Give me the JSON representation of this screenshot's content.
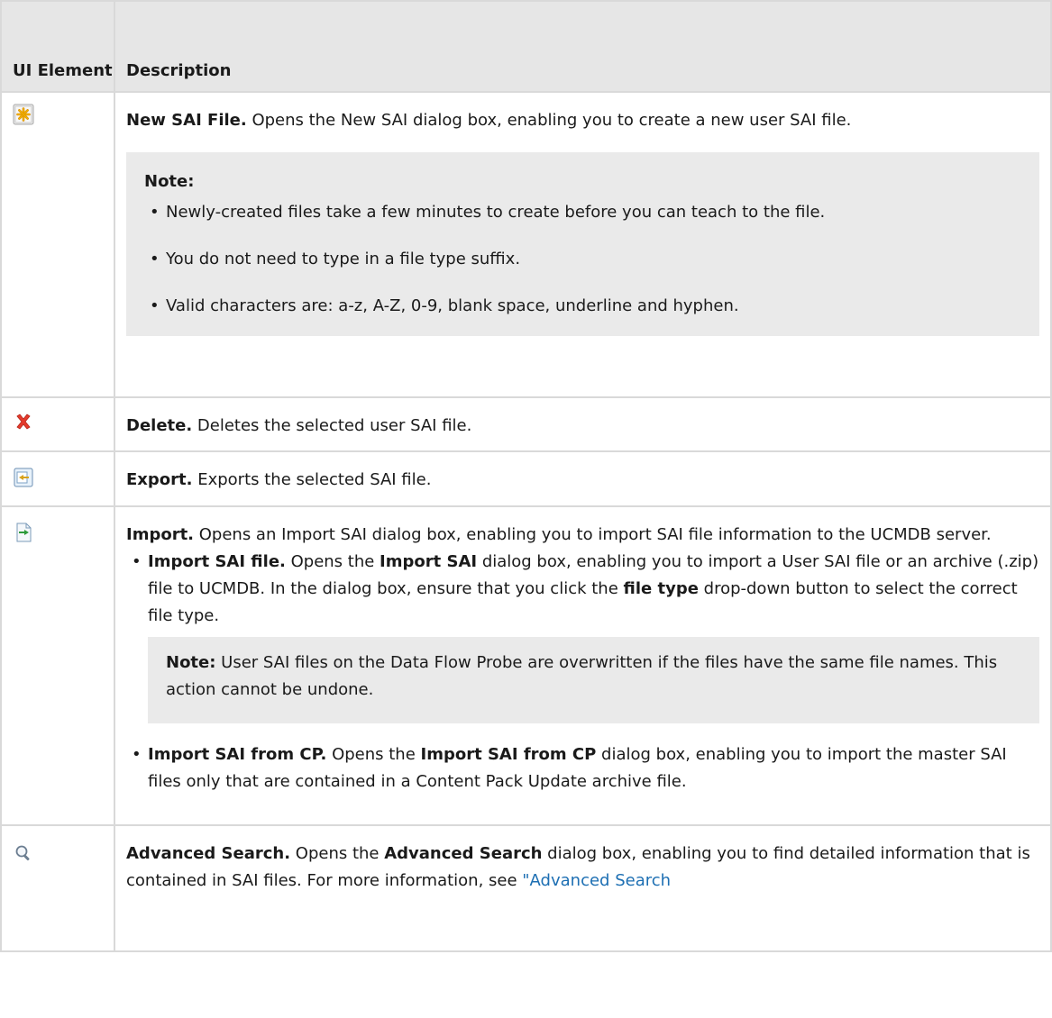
{
  "header": {
    "col1": "UI Element",
    "col2": "Description"
  },
  "rows": [
    {
      "icon": "new-file-icon",
      "title": "New SAI File.",
      "text": " Opens the New SAI dialog box, enabling you to create a new user SAI file.",
      "note_label": "Note:",
      "note_items": [
        "Newly-created files take a few minutes to create before you can teach to the file.",
        "You do not need to type in a file type suffix.",
        "Valid characters are: a-z, A-Z, 0-9, blank space, underline and hyphen."
      ]
    },
    {
      "icon": "delete-icon",
      "title": "Delete.",
      "text": " Deletes the selected user SAI file."
    },
    {
      "icon": "export-icon",
      "title": "Export.",
      "text": " Exports the selected SAI file."
    },
    {
      "icon": "import-icon",
      "title": "Import.",
      "text": " Opens an Import SAI dialog box, enabling you to import SAI file information to the UCMDB server.",
      "sub1": {
        "title": "Import SAI file.",
        "t1": " Opens the ",
        "b1": "Import SAI",
        "t2": " dialog box, enabling you to import a User SAI file or an archive (.zip) file to UCMDB. In the dialog box, ensure that you click the ",
        "b2": "file type",
        "t3": " drop-down button to select the correct file type.",
        "note_label": "Note:",
        "note_text": " User SAI files on the Data Flow Probe are overwritten if the files have the same file names. This action cannot be undone."
      },
      "sub2": {
        "title": "Import SAI from CP.",
        "t1": " Opens the ",
        "b1": "Import SAI from CP",
        "t2": " dialog box, enabling you to import the master SAI files only that are contained in a Content Pack Update archive file."
      }
    },
    {
      "icon": "search-icon",
      "title": "Advanced Search.",
      "t1": " Opens the ",
      "b1": "Advanced Search",
      "t2": " dialog box, enabling you to find detailed information that is contained in SAI files. For more information, see ",
      "link": "\"Advanced Search"
    }
  ]
}
